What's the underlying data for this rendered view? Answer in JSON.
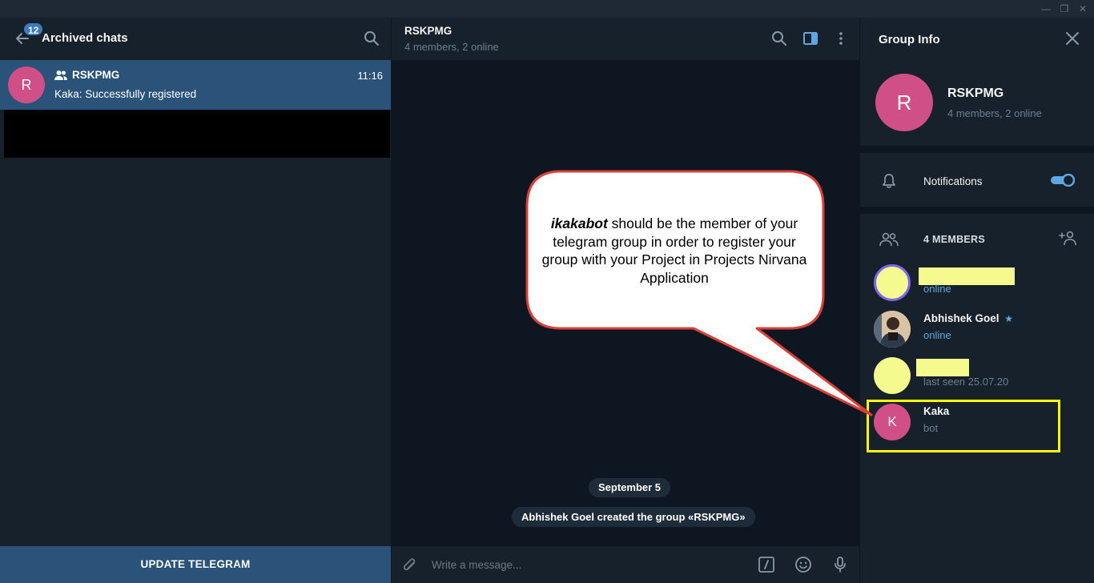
{
  "sidebar": {
    "title": "Archived chats",
    "badge": "12",
    "chats": [
      {
        "name": "RSKPMG",
        "time": "11:16",
        "preview": "Kaka: Successfully registered",
        "avatar_letter": "R"
      }
    ],
    "update_button": "UPDATE TELEGRAM"
  },
  "chat": {
    "title": "RSKPMG",
    "subtitle": "4 members, 2 online",
    "date_label": "September 5",
    "service_message": "Abhishek Goel created the group «RSKPMG»",
    "composer_placeholder": "Write a message..."
  },
  "group_info": {
    "title": "Group Info",
    "avatar_letter": "R",
    "name": "RSKPMG",
    "subtitle": "4 members, 2 online",
    "notifications_label": "Notifications",
    "notifications_on": true,
    "members_label": "4 MEMBERS",
    "members": [
      {
        "name": "",
        "status": "online",
        "online": true
      },
      {
        "name": "Abhishek Goel",
        "status": "online",
        "online": true
      },
      {
        "name": "",
        "status": "last seen 25.07.20",
        "online": false
      },
      {
        "name": "Kaka",
        "status": "bot",
        "online": false,
        "avatar_letter": "K"
      }
    ]
  },
  "callout": {
    "bold_word": "ikakabot",
    "text": " should be the member of your telegram group in order to register your group with your Project in Projects Nirvana Application"
  },
  "colors": {
    "accent": "#2b5278",
    "avatar_pink": "#cf4f86",
    "online": "#5fa7e2",
    "highlight": "#ffff00",
    "callout_border": "#d9403a"
  }
}
